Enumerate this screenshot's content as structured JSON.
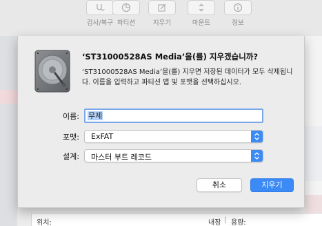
{
  "toolbar": {
    "items": [
      {
        "label": "검사/복구",
        "icon": "stethoscope-icon"
      },
      {
        "label": "파티션",
        "icon": "partition-icon"
      },
      {
        "label": "지우기",
        "icon": "erase-icon"
      },
      {
        "label": "마운트",
        "icon": "mount-icon"
      },
      {
        "label": "정보",
        "icon": "info-icon"
      }
    ]
  },
  "info_table": {
    "location_label": "위치:",
    "location_value": "내장",
    "capacity_label": "용량:"
  },
  "dialog": {
    "title": "‘ST31000528AS Media’을(를) 지우겠습니까?",
    "message": "‘ST31000528AS Media’을(를) 지우면 저장된 데이터가 모두 삭제됩니다. 이름을 입력하고 파티션 맵 및 포맷을 선택하십시오.",
    "name_label": "이름:",
    "name_value": "무제",
    "format_label": "포맷:",
    "format_value": "ExFAT",
    "scheme_label": "설계:",
    "scheme_value": "마스터 부트 레코드",
    "cancel_label": "취소",
    "erase_label": "지우기"
  },
  "colors": {
    "accent": "#3b8af5",
    "focus_ring": "#7aa8e9",
    "selection": "#b3d2fb"
  }
}
